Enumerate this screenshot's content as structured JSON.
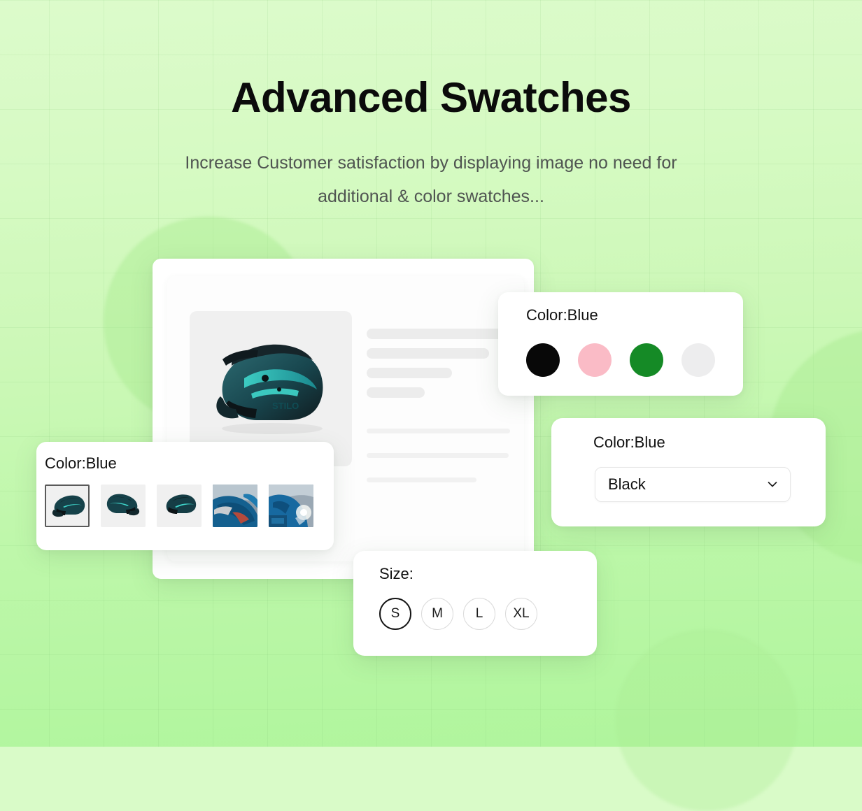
{
  "header": {
    "title": "Advanced Swatches",
    "subtitle": "Increase Customer satisfaction by displaying image no need for additional & color swatches..."
  },
  "product_card": {
    "image_alt": "motocross-helmet-teal"
  },
  "color_circles_card": {
    "label": "Color:Blue",
    "swatches": [
      {
        "name": "black",
        "color": "#080808"
      },
      {
        "name": "pink",
        "color": "#FABBC6"
      },
      {
        "name": "green",
        "color": "#158A26"
      },
      {
        "name": "light-gray",
        "color": "#EDEDEE"
      }
    ]
  },
  "dropdown_card": {
    "label": "Color:Blue",
    "selected_value": "Black",
    "chevron": "chevron-down-icon"
  },
  "image_swatch_card": {
    "label": "Color:Blue",
    "thumbnails": [
      {
        "name": "helmet-left-view",
        "selected": true
      },
      {
        "name": "helmet-right-view",
        "selected": false
      },
      {
        "name": "helmet-angle-view",
        "selected": false
      },
      {
        "name": "rider-photo-1",
        "selected": false
      },
      {
        "name": "rider-photo-2",
        "selected": false
      }
    ]
  },
  "size_card": {
    "label": "Size:",
    "options": [
      {
        "label": "S",
        "selected": true
      },
      {
        "label": "M",
        "selected": false
      },
      {
        "label": "L",
        "selected": false
      },
      {
        "label": "XL",
        "selected": false
      }
    ]
  },
  "colors": {
    "background_top": "#DCFBCB",
    "background_bottom": "#AFF59C",
    "card_background": "#FFFFFF",
    "title_color": "#0B0B0B",
    "subtitle_color": "#4F5451"
  }
}
